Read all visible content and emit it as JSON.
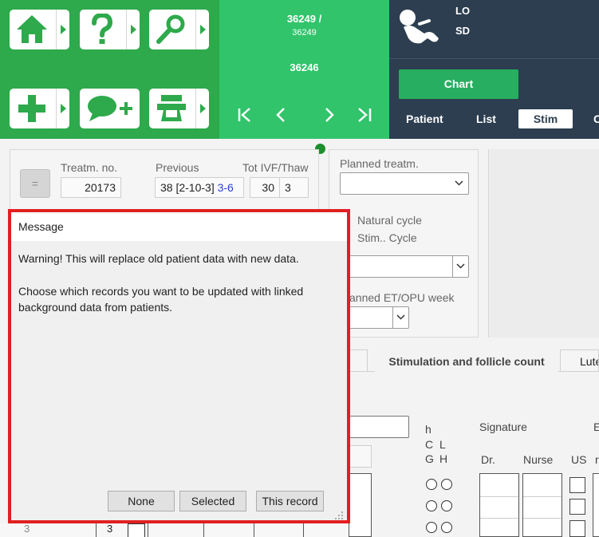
{
  "toolbar": {
    "buttons": [
      {
        "icon": "home-icon"
      },
      {
        "icon": "help-icon"
      },
      {
        "icon": "search-icon"
      },
      {
        "icon": "add-icon"
      },
      {
        "icon": "add-message-icon"
      },
      {
        "icon": "device-icon"
      }
    ]
  },
  "patient_nav": {
    "id_line1": "36249 /",
    "id_line2": "36249",
    "id_line3": "36246"
  },
  "patient": {
    "line1": "LO",
    "line2": "SD"
  },
  "header_tabs": {
    "chart_label": "Chart",
    "tabs": [
      "Patient",
      "List",
      "Stim",
      "C"
    ],
    "active": "Stim"
  },
  "form": {
    "eq_button": "=",
    "treatm_no_label": "Treatm. no.",
    "treatm_no_value": "20173",
    "previous_label": "Previous",
    "previous_value": "38 [2-10-3]",
    "previous_link": "3-6",
    "tot_label": "Tot IVF/Thaw",
    "tot_ivf": "30",
    "tot_thaw": "3",
    "planned_label": "Planned treatm.",
    "natural_cycle": "Natural cycle",
    "stim_cycle": "Stim.. Cycle",
    "planned_et_label": "anned ET/OPU week",
    "stim_tabs": [
      "Stimulation and follicle count",
      "Lute"
    ],
    "col_h": "h",
    "col_c": "C",
    "col_g": "G",
    "col_l": "L",
    "col_h2": "H",
    "signature_label": "Signature",
    "dr_label": "Dr.",
    "nurse_label": "Nurse",
    "us_label": "US",
    "col_e": "E",
    "col_r": "r",
    "row_no": "3",
    "row_val": "3"
  },
  "dialog": {
    "title": "Message",
    "line1": "Warning! This will replace old patient data with new data.",
    "line2": "Choose which records you want to be updated with linked background data from patients.",
    "btn_none": "None",
    "btn_selected": "Selected",
    "btn_this_record": "This record"
  },
  "colors": {
    "toolbar_green": "#2ea94b",
    "nav_green": "#31c46b",
    "dark_header": "#2c3e50",
    "highlight_red": "#e02020"
  }
}
